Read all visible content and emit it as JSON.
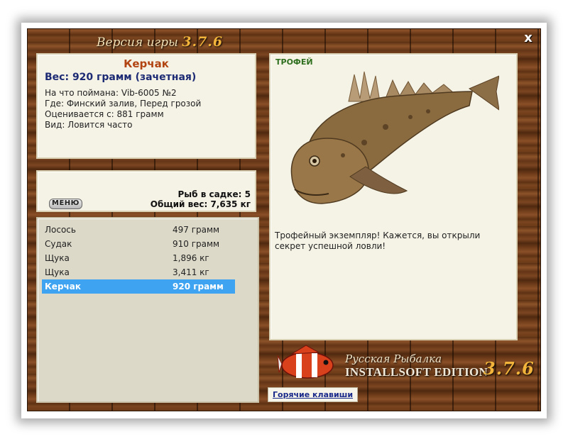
{
  "window": {
    "title_prefix": "Версия игры",
    "title_version": "3.7.6",
    "close_glyph": "x"
  },
  "fish_info": {
    "name": "Керчак",
    "weight": "Вес: 920 грамм (зачетная)",
    "caught_on": "На что поймана: Vib-6005 №2",
    "location": "Где: Финский залив, Перед грозой",
    "valued_from": "Оценивается с: 881 грамм",
    "species_note": "Вид: Ловится часто"
  },
  "summary": {
    "menu_label": "МЕНЮ",
    "fish_count": "Рыб в садке: 5",
    "total_weight": "Общий вес: 7,635 кг"
  },
  "catch_list": [
    {
      "name": "Лосось",
      "weight": "497 грамм"
    },
    {
      "name": "Судак",
      "weight": "910 грамм"
    },
    {
      "name": "Щука",
      "weight": "1,896 кг"
    },
    {
      "name": "Щука",
      "weight": "3,411 кг"
    },
    {
      "name": "Керчак",
      "weight": "920 грамм",
      "selected": true
    }
  ],
  "trophy": {
    "label": "ТРОФЕЙ",
    "text": "Трофейный экземпляр! Кажется, вы открыли секрет успешной ловли!"
  },
  "logo": {
    "title": "Русская Рыбалка",
    "edition": "INSTALLSOFT EDITION",
    "version": "3.7.6"
  },
  "hotkeys_label": "Горячие клавиши",
  "colors": {
    "selection": "#3ea3f0",
    "fish_name": "#b14410",
    "weight_text": "#1d2b74",
    "trophy_label": "#2f6f1f",
    "version_accent": "#f2b43a"
  }
}
